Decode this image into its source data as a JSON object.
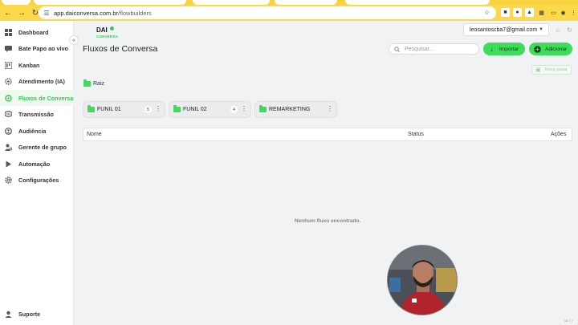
{
  "browser": {
    "url_host": "app.daiconversa.com.br",
    "url_path": "/flowbuilders"
  },
  "logo": {
    "title": "DAI",
    "subtitle": "CONVERSA"
  },
  "sidebar": {
    "items": [
      {
        "label": "Dashboard",
        "icon": "dashboard-icon"
      },
      {
        "label": "Bate Papo ao vivo",
        "icon": "chat-icon"
      },
      {
        "label": "Kanban",
        "icon": "kanban-icon"
      },
      {
        "label": "Atendimento (IA)",
        "icon": "gear-icon"
      },
      {
        "label": "Fluxos de Conversa",
        "icon": "flow-icon",
        "active": true
      },
      {
        "label": "Transmissão",
        "icon": "broadcast-icon"
      },
      {
        "label": "Audiência",
        "icon": "audience-icon"
      },
      {
        "label": "Gerente de grupo",
        "icon": "group-manager-icon"
      },
      {
        "label": "Automação",
        "icon": "play-icon"
      },
      {
        "label": "Configurações",
        "icon": "settings-icon"
      }
    ],
    "support_label": "Suporte"
  },
  "header": {
    "user_email": "leosantoscba7@gmail.com"
  },
  "page": {
    "title": "Fluxos de Conversa",
    "search_placeholder": "Pesquisar...",
    "import_label": "Importar",
    "add_label": "Adicionar",
    "new_folder_label": "Nova pasta",
    "breadcrumb_root": "Raiz"
  },
  "folders": [
    {
      "name": "FUNIL 01",
      "count": "5"
    },
    {
      "name": "FUNIL 02",
      "count": "4"
    },
    {
      "name": "REMARKETING",
      "count": ""
    }
  ],
  "table": {
    "columns": [
      "Nome",
      "Status",
      "Ações"
    ],
    "empty_message": "Nenhum fluxo encontrado."
  },
  "version": "v2.7.7",
  "colors": {
    "accent": "#3ddc5a",
    "browser_bar": "#fbd94a"
  }
}
